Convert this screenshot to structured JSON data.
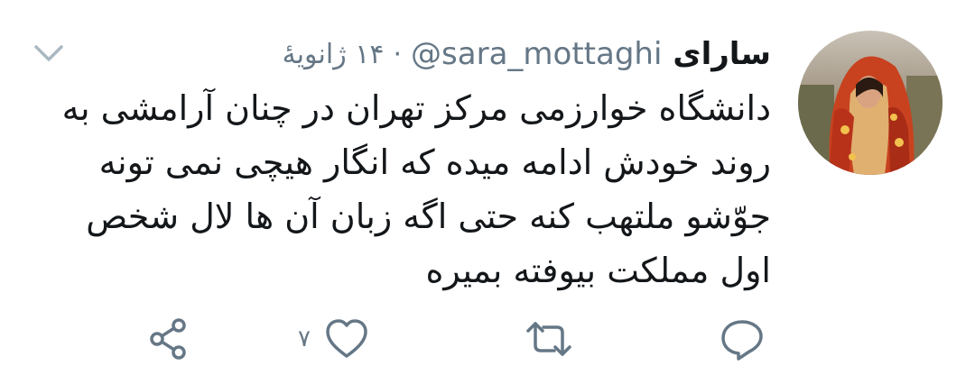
{
  "tweet": {
    "display_name": "سارای",
    "handle": "@sara_mottaghi",
    "separator": "·",
    "timestamp": "۱۴ ژانویهٔ",
    "text_lines": [
      "دانشگاه خوارزمی مرکز تهران در چنان آرامشی به",
      "روند خودش ادامه میده که انگار هیچی نمی تونه",
      "جوّشو ملتهب کنه حتی اگه زبان آن ها لال شخص",
      "اول مملکت بیوفته بمیره"
    ],
    "actions": {
      "reply_icon": "reply-icon",
      "retweet_icon": "retweet-icon",
      "like_icon": "heart-icon",
      "like_count": "۷",
      "share_icon": "share-icon"
    }
  },
  "colors": {
    "text": "#14171a",
    "secondary": "#657786",
    "background": "#ffffff"
  }
}
